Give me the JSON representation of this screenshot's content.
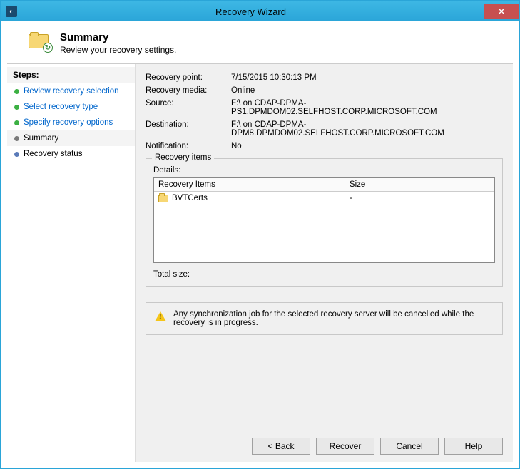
{
  "window": {
    "title": "Recovery Wizard"
  },
  "header": {
    "title": "Summary",
    "subtitle": "Review your recovery settings."
  },
  "sidebar": {
    "steps_label": "Steps:",
    "items": [
      {
        "label": "Review recovery selection",
        "state": "done"
      },
      {
        "label": "Select recovery type",
        "state": "done"
      },
      {
        "label": "Specify recovery options",
        "state": "done"
      },
      {
        "label": "Summary",
        "state": "current"
      },
      {
        "label": "Recovery status",
        "state": "pending"
      }
    ]
  },
  "summary": {
    "rows": {
      "recovery_point": {
        "label": "Recovery point:",
        "value": "7/15/2015 10:30:13 PM"
      },
      "recovery_media": {
        "label": "Recovery media:",
        "value": "Online"
      },
      "source": {
        "label": "Source:",
        "value": "F:\\ on CDAP-DPMA-PS1.DPMDOM02.SELFHOST.CORP.MICROSOFT.COM"
      },
      "destination": {
        "label": "Destination:",
        "value": "F:\\ on CDAP-DPMA-DPM8.DPMDOM02.SELFHOST.CORP.MICROSOFT.COM"
      },
      "notification": {
        "label": "Notification:",
        "value": "No"
      }
    },
    "group_title": "Recovery items",
    "details_label": "Details:",
    "table": {
      "columns": {
        "items": "Recovery Items",
        "size": "Size"
      },
      "rows": [
        {
          "name": "BVTCerts",
          "size": "-"
        }
      ]
    },
    "total_label": "Total size:",
    "total_value": ""
  },
  "notice": {
    "text": "Any synchronization job for the selected recovery server will be cancelled while the recovery is in progress."
  },
  "buttons": {
    "back": "< Back",
    "recover": "Recover",
    "cancel": "Cancel",
    "help": "Help"
  }
}
